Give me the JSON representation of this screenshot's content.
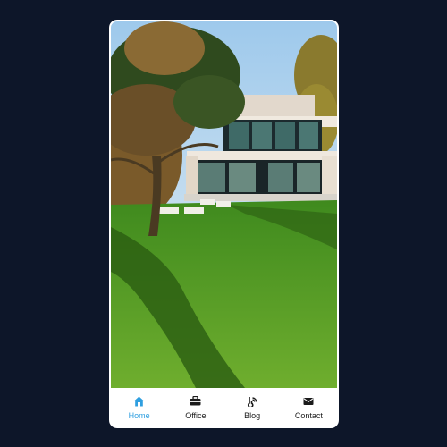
{
  "colors": {
    "background": "#0d1629",
    "active": "#2f9fe0",
    "inactive": "#1b1b1b"
  },
  "hero": {
    "image": "modern-house-garden-photo"
  },
  "nav": {
    "items": [
      {
        "label": "Home",
        "icon": "home-icon",
        "active": true
      },
      {
        "label": "Office",
        "icon": "briefcase-icon",
        "active": false
      },
      {
        "label": "Blog",
        "icon": "blog-icon",
        "active": false
      },
      {
        "label": "Contact",
        "icon": "mail-icon",
        "active": false
      }
    ]
  }
}
